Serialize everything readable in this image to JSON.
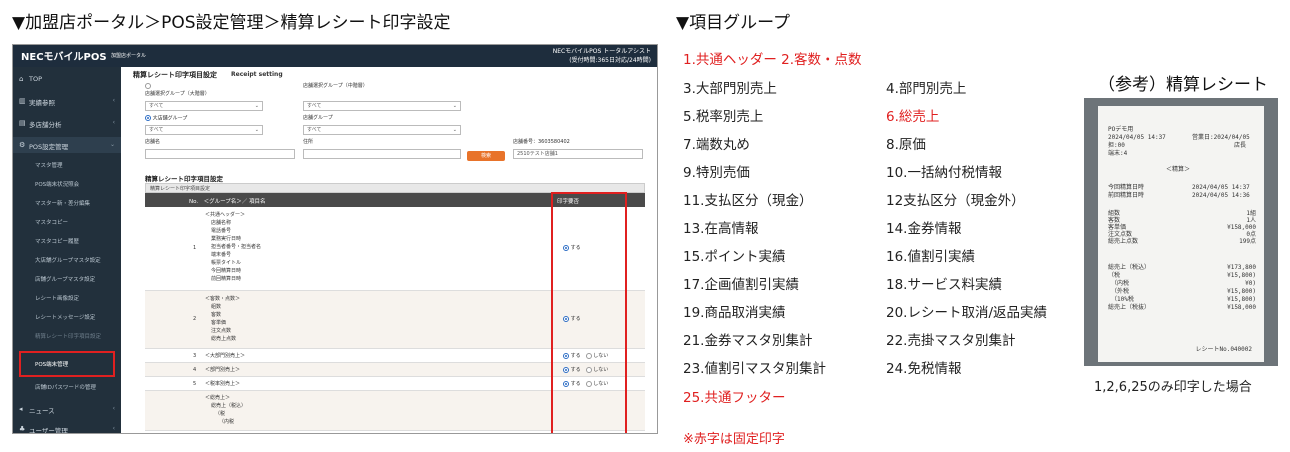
{
  "headings": {
    "left": "▼加盟店ポータル＞POS設定管理＞精算レシート印字設定",
    "middle": "▼項目グループ",
    "right": "（参考）精算レシート"
  },
  "app": {
    "brand": "NECモバイルPOS",
    "brand_sub": "加盟店ポータル",
    "assist_line1": "NECモバイルPOS トータルアシスト",
    "assist_line2": "(受付時間:365日対応/24時間)"
  },
  "sidebar": {
    "items": [
      {
        "icon": "home-icon",
        "glyph": "⌂",
        "label": "TOP",
        "chevron": ""
      },
      {
        "icon": "bar-chart-icon",
        "glyph": "▥",
        "label": "実績参照",
        "chevron": "‹"
      },
      {
        "icon": "document-icon",
        "glyph": "▤",
        "label": "多店舗分析",
        "chevron": "‹"
      },
      {
        "icon": "gear-icon",
        "glyph": "⚙",
        "label": "POS設定管理",
        "chevron": "⌄"
      },
      {
        "icon": "megaphone-icon",
        "glyph": "◂",
        "label": "ニュース",
        "chevron": "‹"
      },
      {
        "icon": "users-icon",
        "glyph": "♣",
        "label": "ユーザー管理",
        "chevron": "‹"
      }
    ],
    "subitems": [
      "マスタ管理",
      "POS端末状況照会",
      "マスター新・差分編集",
      "マスタコピー",
      "マスタコピー履歴",
      "大店舗グループマスタ設定",
      "店舗グループマスタ設定",
      "レシート画像設定",
      "レシートメッセージ設定",
      "精算レシート印字項目設定",
      "POS端末管理",
      "店舗IDパスワードの管理"
    ]
  },
  "main": {
    "page_title": "精算レシート印字項目設定",
    "page_title_en": "Receipt setting",
    "filters": {
      "store_group_label": "店舗選択グループ（大階層）",
      "store_group_value": "すべて",
      "store_group2_label": "店舗選択グループ（中階層）",
      "store_group2_value": "すべて",
      "large_group_label": "大店舗グループ",
      "large_group_value": "すべて",
      "store_group3_label": "店舗グループ",
      "store_group3_value": "すべて",
      "store_name_label": "店舗名",
      "address_label": "住所",
      "store_code_label": "店舗番号：3603580402",
      "store_code_value": "2510テスト店舗1",
      "search_button": "検索"
    },
    "section_title": "精算レシート印字項目設定",
    "table_caption": "精算レシート印字項目設定",
    "col_no": "No.　＜グループ名＞／ 項目名",
    "col_print": "印字要否",
    "opt_yes": "する",
    "opt_no": "しない",
    "rows": [
      {
        "no": "1",
        "lines": [
          "＜共通ヘッダー＞",
          "店舗名称",
          "電話番号",
          "業務実行日時",
          "担当者番号・担当者名",
          "端末番号",
          "帳票タイトル",
          "今回精算日時",
          "前回精算日時"
        ],
        "fixed": true
      },
      {
        "no": "2",
        "lines": [
          "＜客数・点数＞",
          "組数",
          "客数",
          "客単価",
          "注文点数",
          "総売上点数"
        ],
        "fixed": true
      },
      {
        "no": "3",
        "lines": [
          "＜大部門別売上＞"
        ],
        "fixed": false
      },
      {
        "no": "4",
        "lines": [
          "＜部門別売上＞"
        ],
        "fixed": false
      },
      {
        "no": "5",
        "lines": [
          "＜税率別売上＞"
        ],
        "fixed": false
      },
      {
        "no": "",
        "lines": [
          "＜総売上＞",
          "総売上（税込）",
          "（税",
          "（内税"
        ],
        "fixed": true
      }
    ]
  },
  "groups": [
    {
      "label": "1.共通ヘッダー 2.客数・点数",
      "red": true
    },
    {
      "label": "3.大部門別売上",
      "red": false
    },
    {
      "label": "4.部門別売上",
      "red": false
    },
    {
      "label": "5.税率別売上",
      "red": false
    },
    {
      "label": "6.総売上",
      "red": true
    },
    {
      "label": "7.端数丸め",
      "red": false
    },
    {
      "label": "8.原価",
      "red": false
    },
    {
      "label": "9.特別売価",
      "red": false
    },
    {
      "label": "10.一括納付税情報",
      "red": false
    },
    {
      "label": "11.支払区分（現金）",
      "red": false
    },
    {
      "label": "12支払区分（現金外）",
      "red": false
    },
    {
      "label": "13.在高情報",
      "red": false
    },
    {
      "label": "14.金券情報",
      "red": false
    },
    {
      "label": "15.ポイント実績",
      "red": false
    },
    {
      "label": "16.値割引実績",
      "red": false
    },
    {
      "label": "17.企画値割引実績",
      "red": false
    },
    {
      "label": "18.サービス料実績",
      "red": false
    },
    {
      "label": "19.商品取消実績",
      "red": false
    },
    {
      "label": "20.レシート取消/返品実績",
      "red": false
    },
    {
      "label": "21.金券マスタ別集計",
      "red": false
    },
    {
      "label": "22.売掛マスタ別集計",
      "red": false
    },
    {
      "label": "23.値割引マスタ別集計",
      "red": false
    },
    {
      "label": "24.免税情報",
      "red": false
    },
    {
      "label": "25.共通フッター",
      "red": true
    }
  ],
  "fixed_note": "※赤字は固定印字",
  "receipt": {
    "store": "POデモ用",
    "date": "2024/04/05 14:37",
    "business_day": "営業日:2024/04/05",
    "staff": "担:00",
    "role": "店長",
    "terminal": "端末:4",
    "title": "＜精算＞",
    "this_label": "今回精算日時",
    "this_value": "2024/04/05 14:37",
    "prev_label": "前回精算日時",
    "prev_value": "2024/04/05 14:36",
    "stats": [
      {
        "k": "組数",
        "v": "1組"
      },
      {
        "k": "客数",
        "v": "1人"
      },
      {
        "k": "客単価",
        "v": "¥158,000"
      },
      {
        "k": "注文点数",
        "v": "0点"
      },
      {
        "k": "総売上点数",
        "v": "199点"
      }
    ],
    "sales": [
      {
        "k": "総売上（税込）",
        "v": "¥173,800"
      },
      {
        "k": "（税",
        "v": "¥15,800)"
      },
      {
        "k": "　（内税",
        "v": "¥0)"
      },
      {
        "k": "　（外税",
        "v": "¥15,800)"
      },
      {
        "k": "　（10%税",
        "v": "¥15,800)"
      },
      {
        "k": "総売上（税抜）",
        "v": "¥158,000"
      }
    ],
    "receipt_no": "レシートNo.040002"
  },
  "caption": "1,2,6,25のみ印字した場合",
  "colors": {
    "accent_red": "#e02020",
    "sidebar": "#22303c",
    "header": "#1e2d3d",
    "search_button": "#e8732a"
  }
}
